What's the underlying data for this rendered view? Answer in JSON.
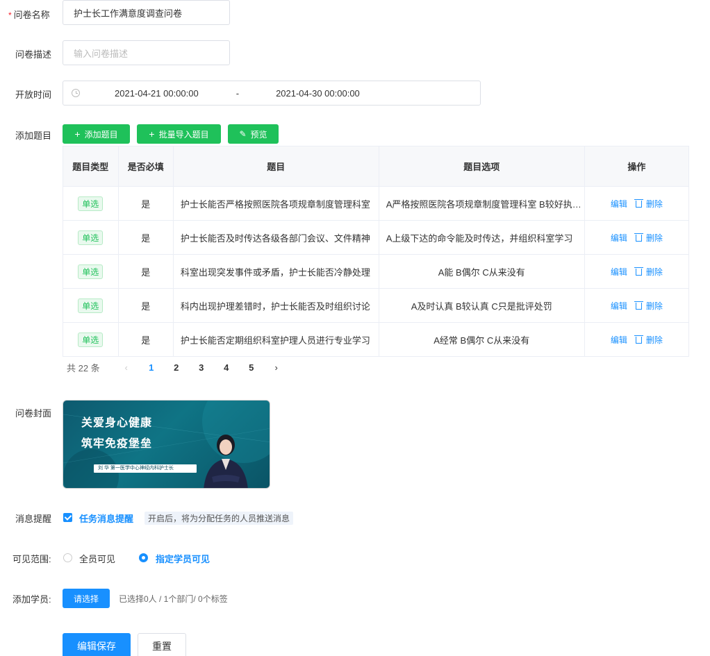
{
  "form": {
    "name_label": "问卷名称",
    "name_value": "护士长工作满意度调查问卷",
    "desc_label": "问卷描述",
    "desc_placeholder": "输入问卷描述",
    "time_label": "开放时间",
    "start_time": "2021-04-21 00:00:00",
    "range_sep": "-",
    "end_time": "2021-04-30 00:00:00",
    "questions_label": "添加题目",
    "cover_label": "问卷封面",
    "reminder_label": "消息提醒",
    "visibility_label": "可见范围:",
    "students_label": "添加学员:"
  },
  "toolbar": {
    "add_question": "添加题目",
    "batch_import": "批量导入题目",
    "preview": "预览"
  },
  "table": {
    "headers": [
      "题目类型",
      "是否必填",
      "题目",
      "题目选项",
      "操作"
    ],
    "rows": [
      {
        "type": "单选",
        "required": "是",
        "question": "护士长能否严格按照医院各项规章制度管理科室",
        "options": "A严格按照医院各项规章制度管理科室 B较好执行 C执行不到位"
      },
      {
        "type": "单选",
        "required": "是",
        "question": "护士长能否及时传达各级各部门会议、文件精神",
        "options": "A上级下达的命令能及时传达，并组织科室学习"
      },
      {
        "type": "单选",
        "required": "是",
        "question": "科室出现突发事件或矛盾，护士长能否冷静处理",
        "options": "A能 B偶尔 C从来没有"
      },
      {
        "type": "单选",
        "required": "是",
        "question": "科内出现护理差错时，护士长能否及时组织讨论",
        "options": "A及时认真 B较认真 C只是批评处罚"
      },
      {
        "type": "单选",
        "required": "是",
        "question": "护士长能否定期组织科室护理人员进行专业学习",
        "options": "A经常 B偶尔 C从来没有"
      }
    ],
    "edit_label": "编辑",
    "delete_label": "删除"
  },
  "pagination": {
    "total": "共 22 条",
    "pages": [
      "1",
      "2",
      "3",
      "4",
      "5"
    ],
    "current": "1"
  },
  "cover": {
    "line1": "关爱身心健康",
    "line2": "筑牢免疫堡垒",
    "caption": "刘 华   第一医学中心神经内科护士长"
  },
  "reminder": {
    "checkbox_label": "任务消息提醒",
    "hint": "开启后，将为分配任务的人员推送消息"
  },
  "visibility": {
    "option_all": "全员可见",
    "option_selected": "指定学员可见",
    "selected": "option_selected"
  },
  "students": {
    "select_button": "请选择",
    "summary": "已选择0人 / 1个部门/ 0个标签"
  },
  "actions": {
    "save": "编辑保存",
    "reset": "重置"
  },
  "colors": {
    "primary": "#1890ff",
    "success": "#1fc15a",
    "required": "#f5222d"
  }
}
